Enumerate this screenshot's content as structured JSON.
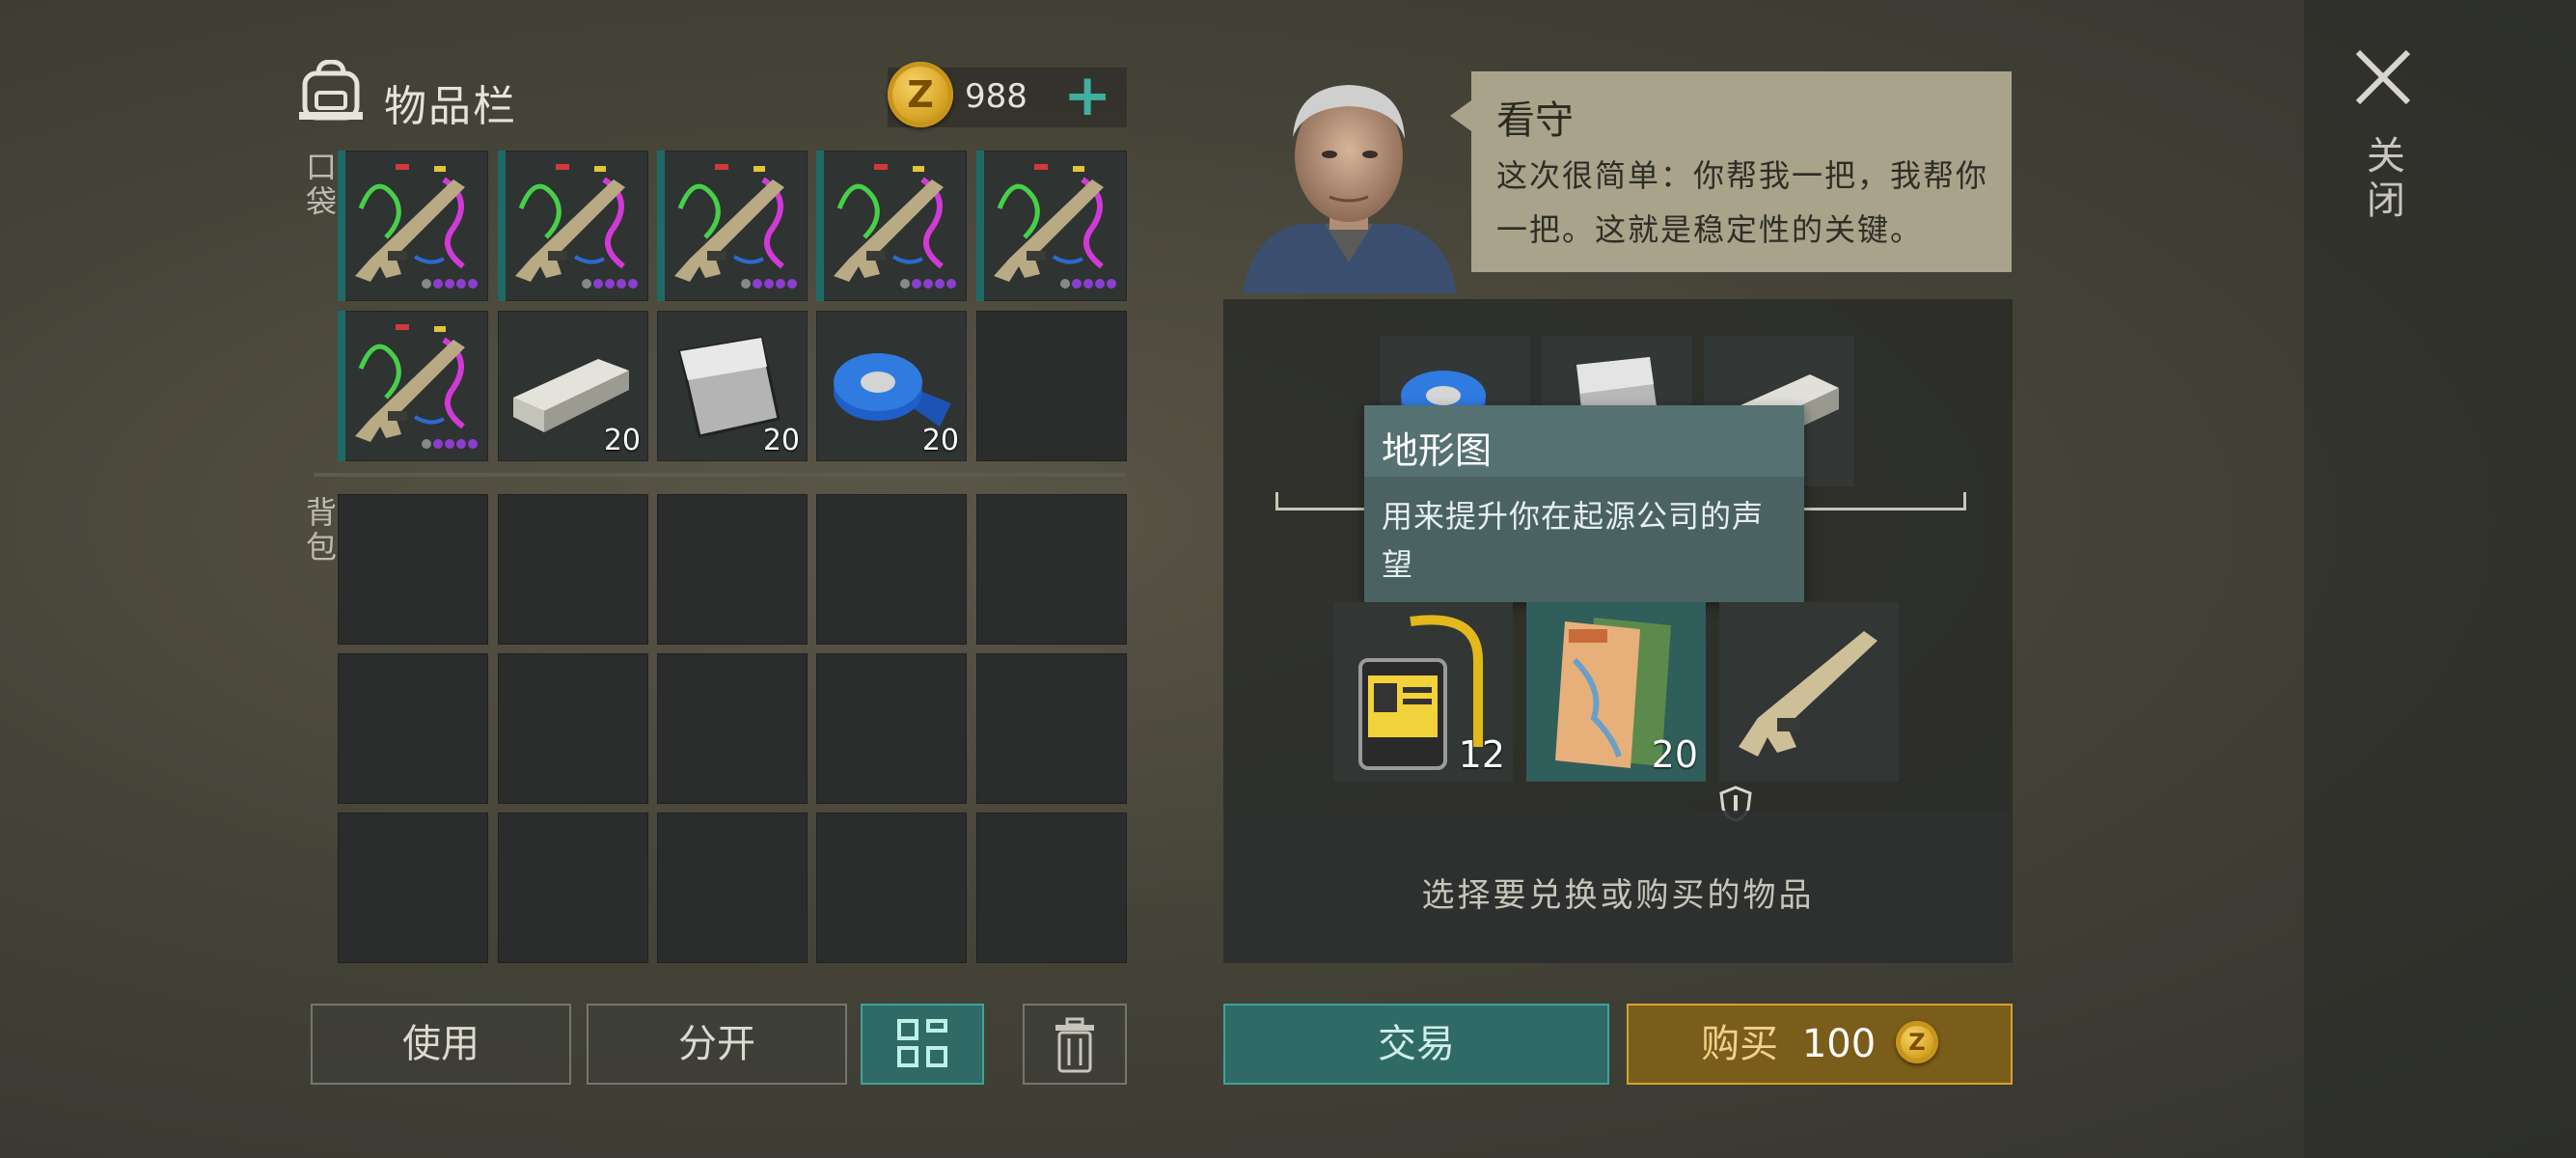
{
  "inventory": {
    "title": "物品栏",
    "coins": "988",
    "add_label": "+",
    "pockets_label": "口袋",
    "backpack_label": "背包",
    "pockets": [
      {
        "name": "confetti-rifle",
        "qty": ""
      },
      {
        "name": "confetti-rifle",
        "qty": ""
      },
      {
        "name": "confetti-rifle",
        "qty": ""
      },
      {
        "name": "confetti-rifle",
        "qty": ""
      },
      {
        "name": "confetti-rifle",
        "qty": ""
      },
      {
        "name": "confetti-rifle",
        "qty": ""
      },
      {
        "name": "metal-bar",
        "qty": "20"
      },
      {
        "name": "metal-sheet",
        "qty": "20"
      },
      {
        "name": "blue-tape",
        "qty": "20"
      },
      {
        "name": "empty",
        "qty": ""
      }
    ]
  },
  "buttons": {
    "use": "使用",
    "split": "分开",
    "trade": "交易",
    "buy": "购买",
    "buy_price": "100"
  },
  "trader": {
    "name": "看守",
    "speech": "这次很简单：你帮我一把，我帮你一把。这就是稳定性的关键。"
  },
  "trade": {
    "hint": "选择要兑换或购买的物品",
    "rewards": [
      {
        "name": "id-card",
        "qty": "12"
      },
      {
        "name": "map",
        "qty": "20"
      },
      {
        "name": "assault-rifle",
        "qty": ""
      }
    ]
  },
  "tooltip": {
    "title": "地形图",
    "description": "用来提升你在起源公司的声望"
  },
  "close_label": "关闭",
  "colors": {
    "teal_accent": "#2f6a66",
    "gold_accent": "#d4a32a",
    "tooltip_bg": "#4b6262"
  }
}
